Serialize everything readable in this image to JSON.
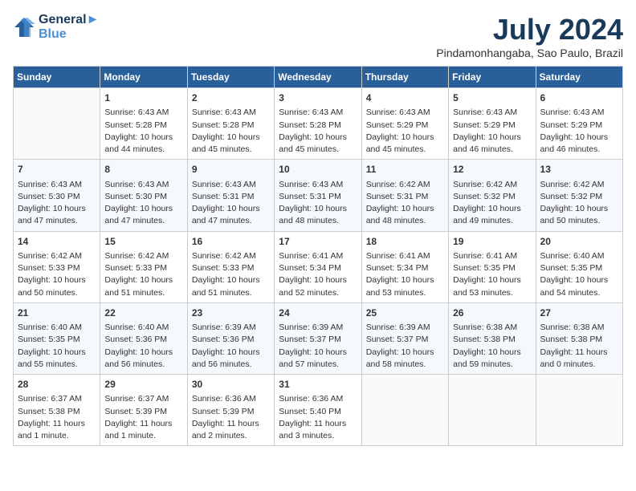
{
  "header": {
    "logo_line1": "General",
    "logo_line2": "Blue",
    "month_title": "July 2024",
    "location": "Pindamonhangaba, Sao Paulo, Brazil"
  },
  "columns": [
    "Sunday",
    "Monday",
    "Tuesday",
    "Wednesday",
    "Thursday",
    "Friday",
    "Saturday"
  ],
  "weeks": [
    [
      {
        "day": "",
        "sunrise": "",
        "sunset": "",
        "daylight": ""
      },
      {
        "day": "1",
        "sunrise": "Sunrise: 6:43 AM",
        "sunset": "Sunset: 5:28 PM",
        "daylight": "Daylight: 10 hours and 44 minutes."
      },
      {
        "day": "2",
        "sunrise": "Sunrise: 6:43 AM",
        "sunset": "Sunset: 5:28 PM",
        "daylight": "Daylight: 10 hours and 45 minutes."
      },
      {
        "day": "3",
        "sunrise": "Sunrise: 6:43 AM",
        "sunset": "Sunset: 5:28 PM",
        "daylight": "Daylight: 10 hours and 45 minutes."
      },
      {
        "day": "4",
        "sunrise": "Sunrise: 6:43 AM",
        "sunset": "Sunset: 5:29 PM",
        "daylight": "Daylight: 10 hours and 45 minutes."
      },
      {
        "day": "5",
        "sunrise": "Sunrise: 6:43 AM",
        "sunset": "Sunset: 5:29 PM",
        "daylight": "Daylight: 10 hours and 46 minutes."
      },
      {
        "day": "6",
        "sunrise": "Sunrise: 6:43 AM",
        "sunset": "Sunset: 5:29 PM",
        "daylight": "Daylight: 10 hours and 46 minutes."
      }
    ],
    [
      {
        "day": "7",
        "sunrise": "Sunrise: 6:43 AM",
        "sunset": "Sunset: 5:30 PM",
        "daylight": "Daylight: 10 hours and 47 minutes."
      },
      {
        "day": "8",
        "sunrise": "Sunrise: 6:43 AM",
        "sunset": "Sunset: 5:30 PM",
        "daylight": "Daylight: 10 hours and 47 minutes."
      },
      {
        "day": "9",
        "sunrise": "Sunrise: 6:43 AM",
        "sunset": "Sunset: 5:31 PM",
        "daylight": "Daylight: 10 hours and 47 minutes."
      },
      {
        "day": "10",
        "sunrise": "Sunrise: 6:43 AM",
        "sunset": "Sunset: 5:31 PM",
        "daylight": "Daylight: 10 hours and 48 minutes."
      },
      {
        "day": "11",
        "sunrise": "Sunrise: 6:42 AM",
        "sunset": "Sunset: 5:31 PM",
        "daylight": "Daylight: 10 hours and 48 minutes."
      },
      {
        "day": "12",
        "sunrise": "Sunrise: 6:42 AM",
        "sunset": "Sunset: 5:32 PM",
        "daylight": "Daylight: 10 hours and 49 minutes."
      },
      {
        "day": "13",
        "sunrise": "Sunrise: 6:42 AM",
        "sunset": "Sunset: 5:32 PM",
        "daylight": "Daylight: 10 hours and 50 minutes."
      }
    ],
    [
      {
        "day": "14",
        "sunrise": "Sunrise: 6:42 AM",
        "sunset": "Sunset: 5:33 PM",
        "daylight": "Daylight: 10 hours and 50 minutes."
      },
      {
        "day": "15",
        "sunrise": "Sunrise: 6:42 AM",
        "sunset": "Sunset: 5:33 PM",
        "daylight": "Daylight: 10 hours and 51 minutes."
      },
      {
        "day": "16",
        "sunrise": "Sunrise: 6:42 AM",
        "sunset": "Sunset: 5:33 PM",
        "daylight": "Daylight: 10 hours and 51 minutes."
      },
      {
        "day": "17",
        "sunrise": "Sunrise: 6:41 AM",
        "sunset": "Sunset: 5:34 PM",
        "daylight": "Daylight: 10 hours and 52 minutes."
      },
      {
        "day": "18",
        "sunrise": "Sunrise: 6:41 AM",
        "sunset": "Sunset: 5:34 PM",
        "daylight": "Daylight: 10 hours and 53 minutes."
      },
      {
        "day": "19",
        "sunrise": "Sunrise: 6:41 AM",
        "sunset": "Sunset: 5:35 PM",
        "daylight": "Daylight: 10 hours and 53 minutes."
      },
      {
        "day": "20",
        "sunrise": "Sunrise: 6:40 AM",
        "sunset": "Sunset: 5:35 PM",
        "daylight": "Daylight: 10 hours and 54 minutes."
      }
    ],
    [
      {
        "day": "21",
        "sunrise": "Sunrise: 6:40 AM",
        "sunset": "Sunset: 5:35 PM",
        "daylight": "Daylight: 10 hours and 55 minutes."
      },
      {
        "day": "22",
        "sunrise": "Sunrise: 6:40 AM",
        "sunset": "Sunset: 5:36 PM",
        "daylight": "Daylight: 10 hours and 56 minutes."
      },
      {
        "day": "23",
        "sunrise": "Sunrise: 6:39 AM",
        "sunset": "Sunset: 5:36 PM",
        "daylight": "Daylight: 10 hours and 56 minutes."
      },
      {
        "day": "24",
        "sunrise": "Sunrise: 6:39 AM",
        "sunset": "Sunset: 5:37 PM",
        "daylight": "Daylight: 10 hours and 57 minutes."
      },
      {
        "day": "25",
        "sunrise": "Sunrise: 6:39 AM",
        "sunset": "Sunset: 5:37 PM",
        "daylight": "Daylight: 10 hours and 58 minutes."
      },
      {
        "day": "26",
        "sunrise": "Sunrise: 6:38 AM",
        "sunset": "Sunset: 5:38 PM",
        "daylight": "Daylight: 10 hours and 59 minutes."
      },
      {
        "day": "27",
        "sunrise": "Sunrise: 6:38 AM",
        "sunset": "Sunset: 5:38 PM",
        "daylight": "Daylight: 11 hours and 0 minutes."
      }
    ],
    [
      {
        "day": "28",
        "sunrise": "Sunrise: 6:37 AM",
        "sunset": "Sunset: 5:38 PM",
        "daylight": "Daylight: 11 hours and 1 minute."
      },
      {
        "day": "29",
        "sunrise": "Sunrise: 6:37 AM",
        "sunset": "Sunset: 5:39 PM",
        "daylight": "Daylight: 11 hours and 1 minute."
      },
      {
        "day": "30",
        "sunrise": "Sunrise: 6:36 AM",
        "sunset": "Sunset: 5:39 PM",
        "daylight": "Daylight: 11 hours and 2 minutes."
      },
      {
        "day": "31",
        "sunrise": "Sunrise: 6:36 AM",
        "sunset": "Sunset: 5:40 PM",
        "daylight": "Daylight: 11 hours and 3 minutes."
      },
      {
        "day": "",
        "sunrise": "",
        "sunset": "",
        "daylight": ""
      },
      {
        "day": "",
        "sunrise": "",
        "sunset": "",
        "daylight": ""
      },
      {
        "day": "",
        "sunrise": "",
        "sunset": "",
        "daylight": ""
      }
    ]
  ]
}
